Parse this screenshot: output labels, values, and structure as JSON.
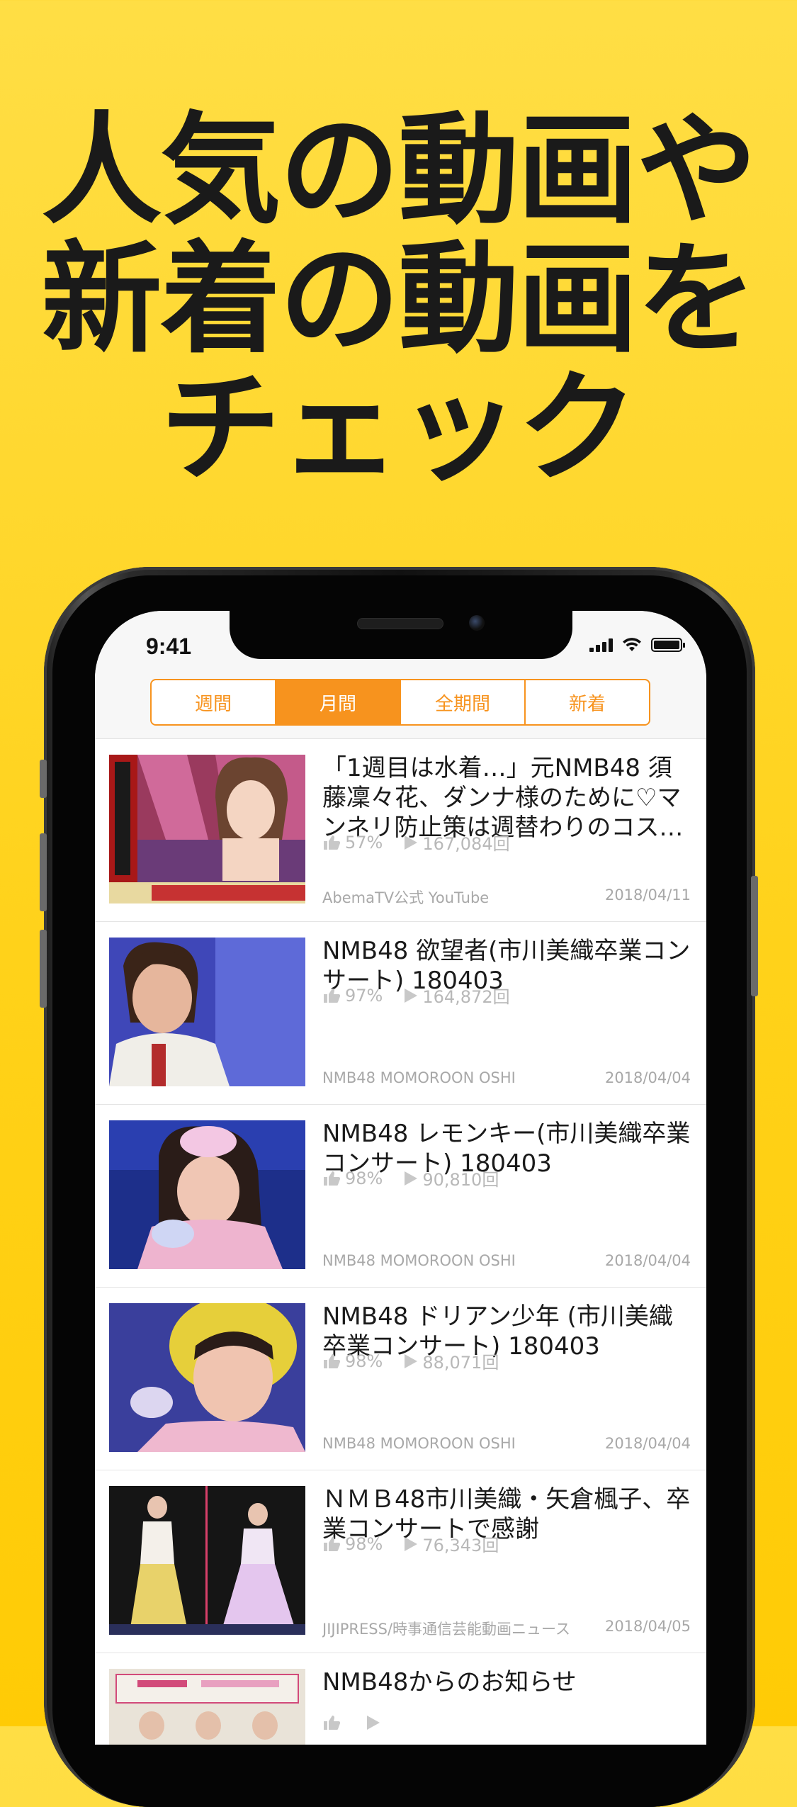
{
  "headline": {
    "line1": "人気の動画や",
    "line2": "新着の動画を",
    "line3": "チェック"
  },
  "status_bar": {
    "time": "9:41"
  },
  "tabs": [
    {
      "label": "週間",
      "active": false
    },
    {
      "label": "月間",
      "active": true
    },
    {
      "label": "全期間",
      "active": false
    },
    {
      "label": "新着",
      "active": false
    }
  ],
  "colors": {
    "accent": "#F7931E",
    "background": "#FFD21A"
  },
  "videos": [
    {
      "title": "「1週目は水着…」元NMB48 須藤凜々花、ダンナ様のために♡マンネリ防止策は週替わりのコスチ…",
      "like_rate": "57%",
      "views": "167,084回",
      "channel": "AbemaTV公式 YouTube",
      "date": "2018/04/11"
    },
    {
      "title": "NMB48 欲望者(市川美織卒業コンサート) 180403",
      "like_rate": "97%",
      "views": "164,872回",
      "channel": "NMB48 MOMOROON OSHI",
      "date": "2018/04/04"
    },
    {
      "title": "NMB48 レモンキー(市川美織卒業コンサート) 180403",
      "like_rate": "98%",
      "views": "90,810回",
      "channel": "NMB48 MOMOROON OSHI",
      "date": "2018/04/04"
    },
    {
      "title": "NMB48 ドリアン少年 (市川美織卒業コンサート) 180403",
      "like_rate": "98%",
      "views": "88,071回",
      "channel": "NMB48 MOMOROON OSHI",
      "date": "2018/04/04"
    },
    {
      "title": "ＮＭＢ48市川美織・矢倉楓子、卒業コンサートで感謝",
      "like_rate": "98%",
      "views": "76,343回",
      "channel": "JIJIPRESS/時事通信芸能動画ニュース",
      "date": "2018/04/05"
    },
    {
      "title": "NMB48からのお知らせ",
      "like_rate": "",
      "views": "",
      "channel": "",
      "date": ""
    }
  ]
}
